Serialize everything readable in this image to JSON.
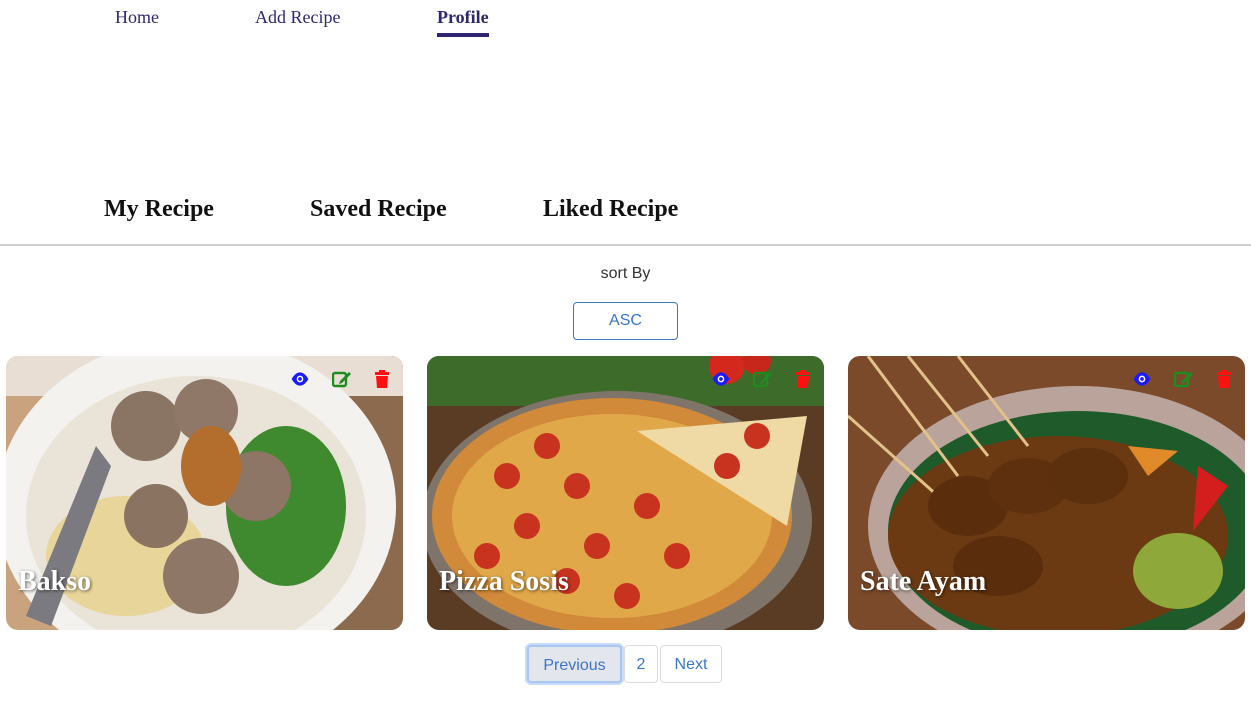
{
  "nav": {
    "items": [
      {
        "label": "Home",
        "active": false
      },
      {
        "label": "Add Recipe",
        "active": false
      },
      {
        "label": "Profile",
        "active": true
      }
    ],
    "accent_color": "#2e266f"
  },
  "tabs": [
    {
      "label": "My Recipe"
    },
    {
      "label": "Saved Recipe"
    },
    {
      "label": "Liked Recipe"
    }
  ],
  "sort": {
    "label": "sort By",
    "button_label": "ASC"
  },
  "cards": [
    {
      "title": "Bakso",
      "icons": [
        "eye-icon",
        "edit-icon",
        "trash-icon"
      ]
    },
    {
      "title": "Pizza Sosis",
      "icons": [
        "eye-icon",
        "edit-icon",
        "trash-icon"
      ]
    },
    {
      "title": "Sate Ayam",
      "icons": [
        "eye-icon",
        "edit-icon",
        "trash-icon"
      ]
    }
  ],
  "icon_colors": {
    "view": "#1a1aff",
    "edit": "#1e8c1e",
    "delete": "#ff1010"
  },
  "pagination": {
    "previous_label": "Previous",
    "page_label": "2",
    "next_label": "Next"
  }
}
